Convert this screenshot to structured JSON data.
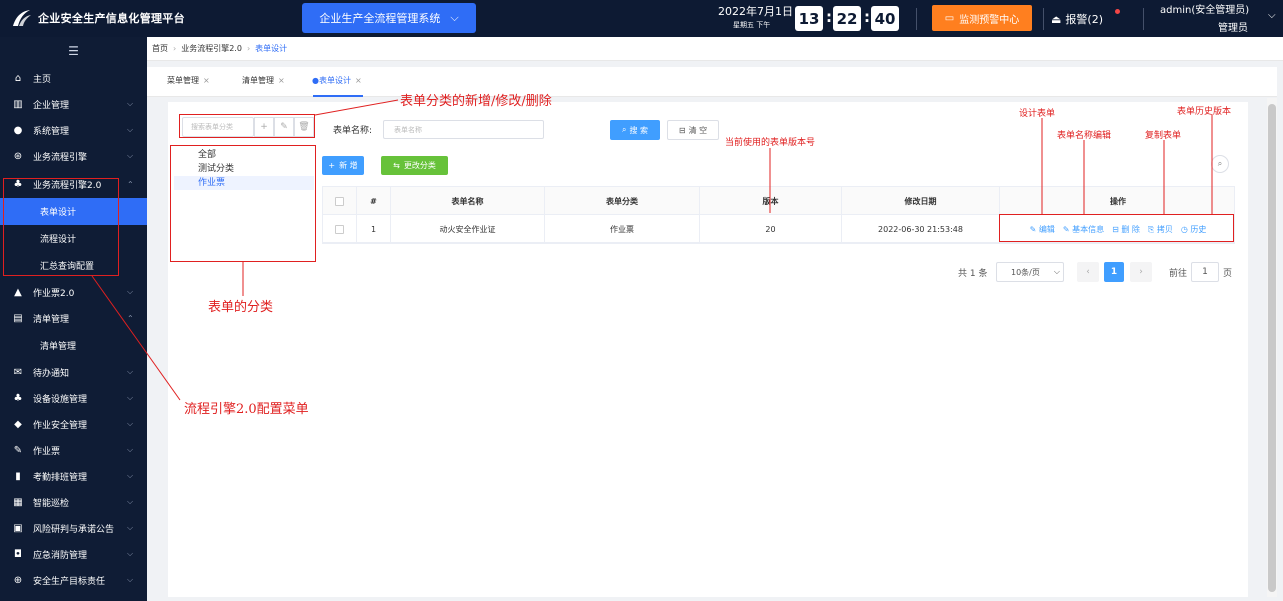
{
  "topbar": {
    "title": "企业安全生产信息化管理平台",
    "system_select": "企业生产全流程管理系统",
    "date": "2022年7月1日",
    "weekday": "星期五 下午",
    "time": {
      "h": "13",
      "m": "22",
      "s": "40"
    },
    "monitor_label": "监测预警中心",
    "alarm_label": "报警(2)",
    "user_name": "admin(安全管理员)",
    "user_role": "管理员"
  },
  "sidebar": {
    "items": [
      {
        "label": "主页",
        "icon": "home-icon"
      },
      {
        "label": "企业管理",
        "icon": "building-icon"
      },
      {
        "label": "系统管理",
        "icon": "gear-icon"
      },
      {
        "label": "业务流程引擎",
        "icon": "flow-icon"
      },
      {
        "label": "业务流程引擎2.0",
        "icon": "flow2-icon"
      },
      {
        "label": "作业票2.0",
        "icon": "ticket-icon"
      },
      {
        "label": "清单管理",
        "icon": "list-icon"
      },
      {
        "label": "待办通知",
        "icon": "mail-icon"
      },
      {
        "label": "设备设施管理",
        "icon": "device-icon"
      },
      {
        "label": "作业安全管理",
        "icon": "shield-icon"
      },
      {
        "label": "作业票",
        "icon": "ticket-icon"
      },
      {
        "label": "考勤排班管理",
        "icon": "chart-icon"
      },
      {
        "label": "智能巡检",
        "icon": "grid-icon"
      },
      {
        "label": "风险研判与承诺公告",
        "icon": "bag-icon"
      },
      {
        "label": "应急消防管理",
        "icon": "fire-icon"
      },
      {
        "label": "安全生产目标责任",
        "icon": "target-icon"
      }
    ],
    "sub_engine": [
      "表单设计",
      "流程设计",
      "汇总查询配置"
    ],
    "sub_list": [
      "清单管理"
    ]
  },
  "breadcrumb": [
    "首页",
    "业务流程引擎2.0",
    "表单设计"
  ],
  "tabs": [
    "菜单管理",
    "清单管理",
    "●表单设计"
  ],
  "category": {
    "search_placeholder": "搜索表单分类",
    "nodes": [
      "全部",
      "测试分类",
      "作业票"
    ]
  },
  "form": {
    "name_label": "表单名称:",
    "name_placeholder": "表单名称",
    "search_label": "搜 索",
    "clear_label": "清 空",
    "add_label": "新 增",
    "change_cat_label": "更改分类"
  },
  "table": {
    "headers": [
      "#",
      "表单名称",
      "表单分类",
      "版本",
      "修改日期",
      "操作"
    ],
    "rows": [
      {
        "idx": "1",
        "name": "动火安全作业证",
        "category": "作业票",
        "version": "20",
        "date": "2022-06-30 21:53:48"
      }
    ],
    "ops": [
      "编辑",
      "基本信息",
      "删 除",
      "拷贝",
      "历史"
    ]
  },
  "pagination": {
    "total": "共 1 条",
    "page_size": "10条/页",
    "current": "1",
    "goto_label": "前往",
    "goto_value": "1",
    "unit": "页"
  },
  "annotations": {
    "category_crud": "表单分类的新增/修改/删除",
    "category_label": "表单的分类",
    "engine_menu": "流程引擎2.0配置菜单",
    "current_version": "当前使用的表单版本号",
    "design_form": "设计表单",
    "edit_name": "表单名称编辑",
    "copy_form": "复制表单",
    "history": "表单历史版本"
  },
  "colors": {
    "topbar": "#0d1a33",
    "sidebar": "#0f1c35",
    "primary": "#2f6df6",
    "warning": "#ff7f1f",
    "success": "#67c23a",
    "annotation": "#e02020"
  }
}
